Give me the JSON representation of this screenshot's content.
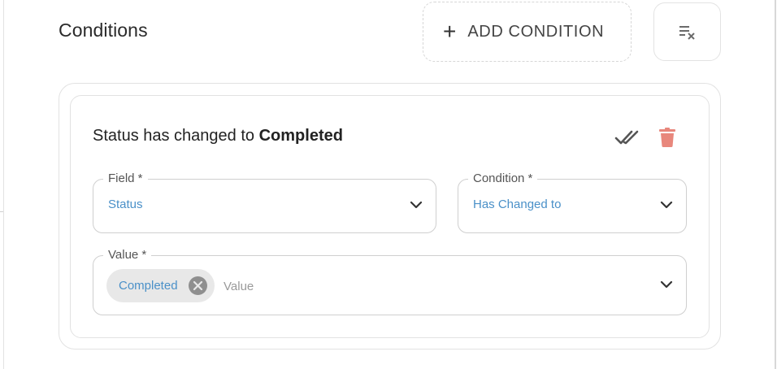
{
  "header": {
    "title": "Conditions",
    "add_label": "ADD CONDITION",
    "add_icon": "plus-icon",
    "clear_icon": "clear-list-icon"
  },
  "condition": {
    "summary_prefix": "Status has changed to",
    "summary_value": "Completed",
    "actions": {
      "done_icon": "double-check-icon",
      "delete_icon": "trash-icon"
    },
    "field": {
      "label": "Field *",
      "value": "Status"
    },
    "condition": {
      "label": "Condition *",
      "value": "Has Changed to"
    },
    "value": {
      "label": "Value *",
      "chips": [
        "Completed"
      ],
      "placeholder": "Value"
    }
  },
  "colors": {
    "accent_text": "#4a90c8",
    "delete": "#e8877c",
    "chip_bg": "#e8e8e8"
  }
}
